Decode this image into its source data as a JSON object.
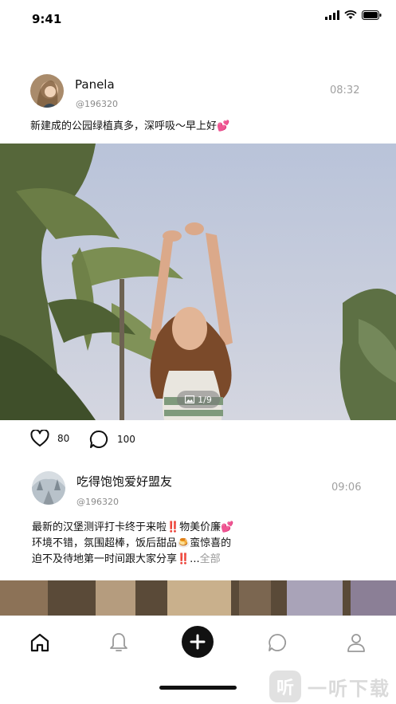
{
  "status": {
    "time": "9:41"
  },
  "posts": [
    {
      "username": "Panela",
      "userid": "@196320",
      "time": "08:32",
      "text": "新建成的公园绿植真多，深呼吸～早上好💕",
      "photo_counter": "1/9",
      "likes": "80",
      "comments": "100"
    },
    {
      "username": "吃得饱饱爱好盟友",
      "userid": "@196320",
      "time": "09:06",
      "text_lines": [
        "最新的汉堡测评打卡终于来啦‼️物美价廉💕",
        "环境不错，氛围超棒，饭后甜品🍮蛮惊喜的",
        "迫不及待地第一时间跟大家分享‼️..."
      ],
      "more_label": "全部"
    }
  ],
  "tabs": [
    "home-icon",
    "bell-icon",
    "add-icon",
    "chat-icon",
    "profile-icon"
  ],
  "watermark": {
    "logo": "听",
    "text": "一听下载"
  }
}
